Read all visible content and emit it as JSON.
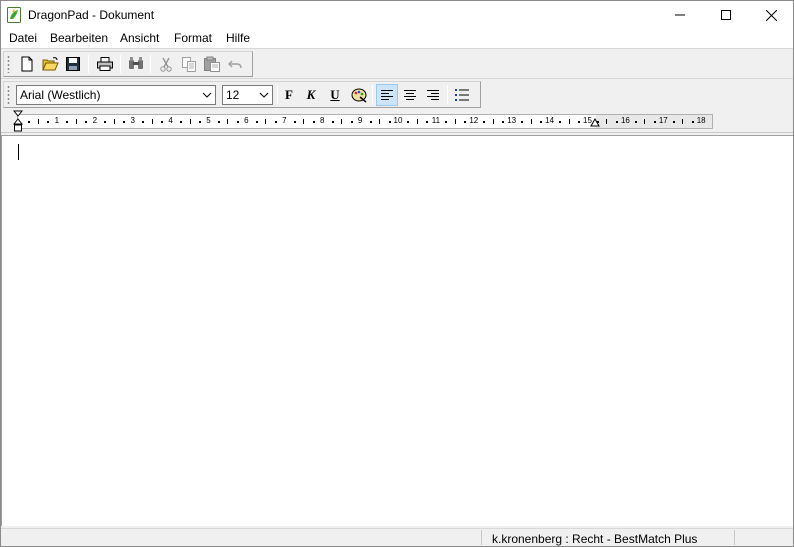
{
  "window": {
    "title": "DragonPad - Dokument"
  },
  "menu": {
    "items": [
      "Datei",
      "Bearbeiten",
      "Ansicht",
      "Format",
      "Hilfe"
    ]
  },
  "toolbar": {
    "icons": [
      "new-document-icon",
      "open-folder-icon",
      "save-icon",
      "print-icon",
      "find-icon",
      "cut-icon",
      "copy-icon",
      "paste-icon",
      "undo-icon"
    ]
  },
  "format_toolbar": {
    "font_name": "Arial (Westlich)",
    "font_size": "12",
    "bold_label": "F",
    "italic_label": "K",
    "underline_label": "U",
    "alignment_selected": "left"
  },
  "ruler": {
    "marks": [
      "1",
      "2",
      "3",
      "4",
      "5",
      "6",
      "7",
      "8",
      "9",
      "10",
      "11",
      "12",
      "13",
      "14",
      "15",
      "16",
      "17",
      "18"
    ]
  },
  "status": {
    "text": "k.kronenberg : Recht - BestMatch Plus"
  },
  "colors": {
    "accent": "#cce4f7",
    "background": "#f0f0f0",
    "app_icon": "#3aa82e"
  }
}
